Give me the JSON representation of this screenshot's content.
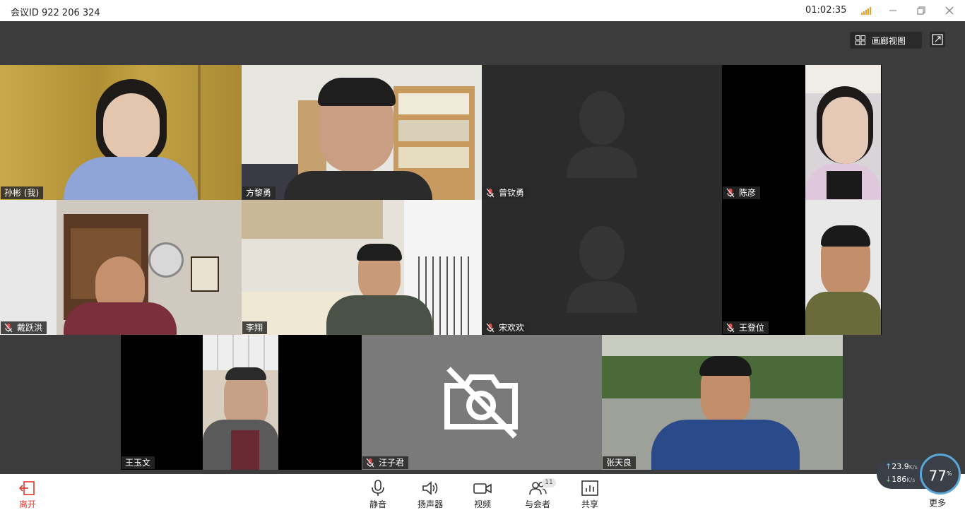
{
  "titlebar": {
    "meeting_id": "会议ID 922 206 324",
    "timer": "01:02:35"
  },
  "view": {
    "mode_label": "画廊视图"
  },
  "participants": [
    {
      "name": "孙彬 (我)",
      "muted": false,
      "self": true
    },
    {
      "name": "方黎勇",
      "muted": false
    },
    {
      "name": "曾钦勇",
      "muted": true,
      "video": false
    },
    {
      "name": "陈彦",
      "muted": true
    },
    {
      "name": "戴跃洪",
      "muted": true
    },
    {
      "name": "李翔",
      "muted": false
    },
    {
      "name": "宋欢欢",
      "muted": true,
      "video": false
    },
    {
      "name": "王登位",
      "muted": true
    },
    {
      "name": "王玉文",
      "muted": false
    },
    {
      "name": "汪子君",
      "muted": true,
      "video": false,
      "camera_off_icon": "camera-off-icon"
    },
    {
      "name": "张天良",
      "muted": false
    }
  ],
  "toolbar": {
    "leave_label": "离开",
    "mute_label": "静音",
    "speaker_label": "扬声器",
    "video_label": "视频",
    "participants_label": "与会者",
    "participants_count": "11",
    "share_label": "共享",
    "more_label": "更多"
  },
  "network": {
    "upload": "23.9",
    "upload_unit": "K/s",
    "download": "186",
    "download_unit": "K/s",
    "cpu": "77",
    "cpu_unit": "%"
  },
  "colors": {
    "accent": "#2e8cf0",
    "leave": "#e0372b",
    "stage_bg": "#3c3c3c",
    "muted_mic": "#e05050"
  }
}
